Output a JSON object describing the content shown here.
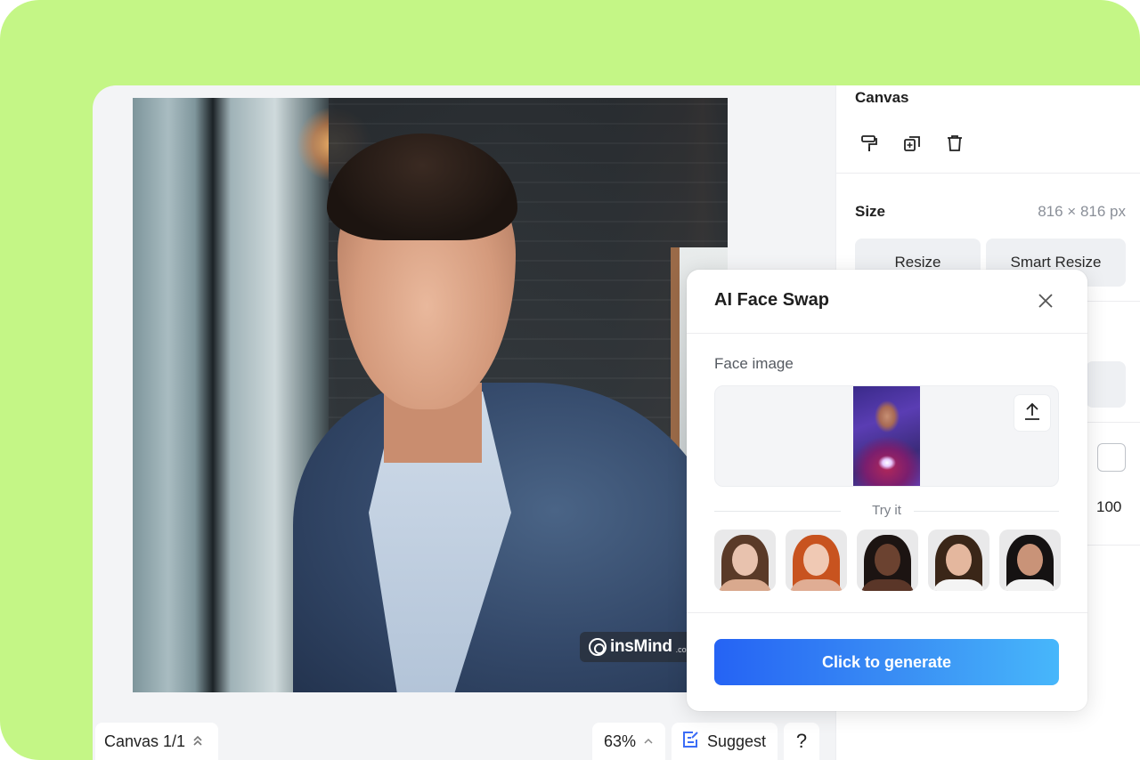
{
  "canvas": {
    "watermark_brand": "insMind",
    "watermark_domain": ".com"
  },
  "bottom_bar": {
    "canvas_page_label": "Canvas 1/1",
    "zoom_level": "63%",
    "suggest_label": "Suggest",
    "help_label": "?"
  },
  "panel": {
    "title": "Canvas",
    "tools": [
      {
        "icon": "paint-roller-icon"
      },
      {
        "icon": "duplicate-icon"
      },
      {
        "icon": "trash-icon"
      }
    ],
    "size_label": "Size",
    "size_value": "816 × 816 px",
    "resize_label": "Resize",
    "smart_resize_label": "Smart Resize",
    "opacity_value": "100"
  },
  "face_swap": {
    "title": "AI Face Swap",
    "face_image_label": "Face image",
    "try_it_label": "Try it",
    "samples": [
      {
        "name": "sample-woman-brunette",
        "hair": "#5a3a28",
        "skin": "#e8c2ae",
        "body": "#d9a98e"
      },
      {
        "name": "sample-woman-redhead",
        "hair": "#c8531f",
        "skin": "#f0c9b4",
        "body": "#e0ad94"
      },
      {
        "name": "sample-woman-dark",
        "hair": "#1c1412",
        "skin": "#6b4230",
        "body": "#5a3628"
      },
      {
        "name": "sample-man-young",
        "hair": "#3a2618",
        "skin": "#e4b79e",
        "body": "#f4f4f4"
      },
      {
        "name": "sample-man-beard",
        "hair": "#151212",
        "skin": "#c99378",
        "body": "#f2f2f2"
      }
    ],
    "generate_label": "Click to generate"
  },
  "colors": {
    "frame_bg": "#c4f686",
    "accent_blue": "#2563f4",
    "accent_cyan": "#47b7fb"
  }
}
